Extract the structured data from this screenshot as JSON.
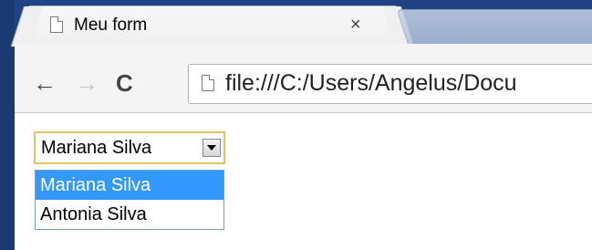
{
  "browser": {
    "tab": {
      "title": "Meu form",
      "close_glyph": "×",
      "icon": "page-icon"
    },
    "toolbar": {
      "back_glyph": "←",
      "forward_glyph": "→",
      "reload_glyph": "C",
      "url": "file:///C:/Users/Angelus/Docu",
      "url_icon": "page-icon"
    }
  },
  "page": {
    "select": {
      "selected": "Mariana Silva",
      "options": [
        {
          "label": "Mariana Silva",
          "highlighted": true
        },
        {
          "label": "Antonia Silva",
          "highlighted": false
        }
      ]
    }
  },
  "colors": {
    "highlight": "#3399ff",
    "frame": "#1d3e7b",
    "select_focus_border": "#e5c365"
  }
}
